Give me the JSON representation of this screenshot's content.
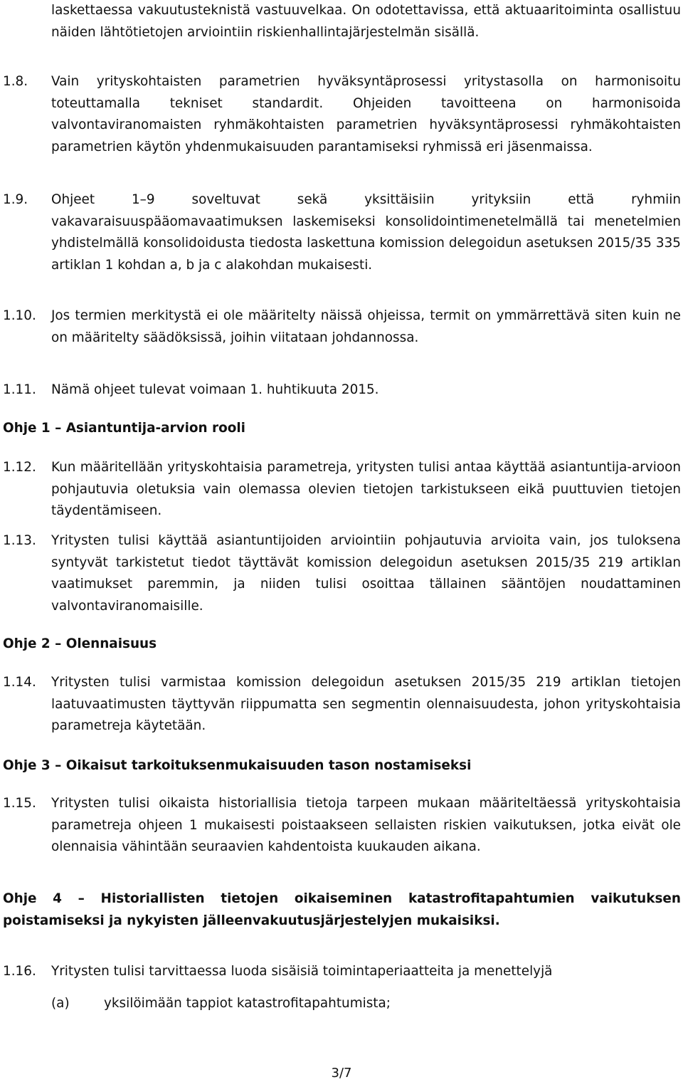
{
  "document": {
    "continuation": "laskettaessa vakuutusteknistä vastuuvelkaa. On odotettavissa, että aktuaaritoiminta osallistuu näiden lähtötietojen arviointiin riskienhallintajärjestelmän sisällä.",
    "paragraphs": [
      {
        "num": "1.8.",
        "text": "Vain yrityskohtaisten parametrien hyväksyntäprosessi yritystasolla on harmonisoitu toteuttamalla tekniset standardit. Ohjeiden tavoitteena on harmonisoida valvontaviranomaisten ryhmäkohtaisten parametrien hyväksyntäprosessi ryhmäkohtaisten parametrien käytön yhdenmukaisuuden parantamiseksi ryhmissä eri jäsenmaissa."
      },
      {
        "num": "1.9.",
        "text": "Ohjeet 1–9 soveltuvat sekä yksittäisiin yrityksiin että ryhmiin vakavaraisuuspääomavaatimuksen laskemiseksi konsolidointimenetelmällä tai menetelmien yhdistelmällä konsolidoidusta tiedosta laskettuna komission delegoidun asetuksen 2015/35 335 artiklan 1 kohdan a, b ja c alakohdan mukaisesti."
      },
      {
        "num": "1.10.",
        "text": "Jos termien merkitystä ei ole määritelty näissä ohjeissa, termit on ymmärrettävä siten kuin ne on määritelty säädöksissä, joihin viitataan johdannossa."
      },
      {
        "num": "1.11.",
        "text": "Nämä ohjeet tulevat voimaan 1. huhtikuuta 2015."
      },
      {
        "num": "1.12.",
        "text": "Kun määritellään yrityskohtaisia parametreja, yritysten tulisi antaa käyttää asiantuntija-arvioon pohjautuvia oletuksia vain olemassa olevien tietojen tarkistukseen eikä puuttuvien tietojen täydentämiseen."
      },
      {
        "num": "1.13.",
        "text": "Yritysten tulisi käyttää asiantuntijoiden arviointiin pohjautuvia arvioita vain, jos tuloksena syntyvät tarkistetut tiedot täyttävät komission delegoidun asetuksen 2015/35 219 artiklan vaatimukset paremmin, ja niiden tulisi osoittaa tällainen sääntöjen noudattaminen valvontaviranomaisille."
      },
      {
        "num": "1.14.",
        "text": "Yritysten tulisi varmistaa komission delegoidun asetuksen 2015/35 219 artiklan tietojen laatuvaatimusten täyttyvän riippumatta sen segmentin olennaisuudesta, johon yrityskohtaisia parametreja käytetään."
      },
      {
        "num": "1.15.",
        "text": "Yritysten tulisi oikaista historiallisia tietoja tarpeen mukaan määriteltäessä yrityskohtaisia parametreja ohjeen 1 mukaisesti poistaakseen sellaisten riskien vaikutuksen, jotka eivät ole olennaisia vähintään seuraavien kahdentoista kuukauden aikana."
      },
      {
        "num": "1.16.",
        "text": "Yritysten tulisi tarvittaessa luoda sisäisiä toimintaperiaatteita ja menettelyjä"
      }
    ],
    "headings": [
      "Ohje 1 – Asiantuntija-arvion rooli",
      "Ohje 2 – Olennaisuus",
      "Ohje 3 – Oikaisut tarkoituksenmukaisuuden tason nostamiseksi",
      "Ohje 4 – Historiallisten tietojen oikaiseminen katastrofitapahtumien vaikutuksen poistamiseksi ja nykyisten jälleenvakuutusjärjestelyjen mukaisiksi."
    ],
    "sub_items": [
      {
        "label": "(a)",
        "text": "yksilöimään tappiot katastrofitapahtumista;"
      }
    ],
    "page_number": "3/7"
  }
}
